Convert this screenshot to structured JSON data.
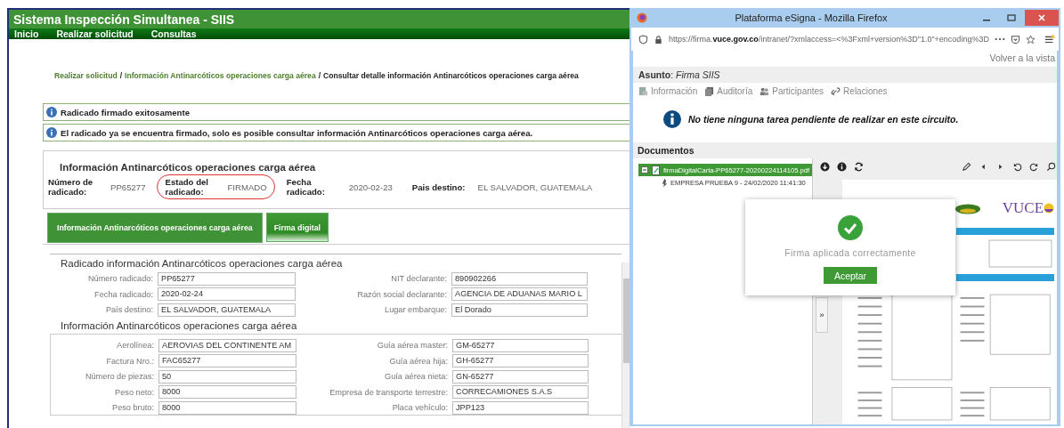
{
  "app": {
    "title": "Sistema Inspección Simultanea - SIIS",
    "nav": [
      "Inicio",
      "Realizar solicitud",
      "Consultas"
    ],
    "breadcrumb": [
      {
        "kind": "link",
        "text": "Realizar solicitud"
      },
      {
        "kind": "separator",
        "text": "/"
      },
      {
        "kind": "link",
        "text": "Información Antinarcóticos operaciones carga aérea"
      },
      {
        "kind": "separator",
        "text": "/"
      },
      {
        "kind": "current",
        "text": "Consultar detalle información Antinarcóticos operaciones carga aérea"
      }
    ],
    "messages": [
      "Radicado firmado exitosamente",
      "El radicado ya se encuentra firmado, solo es posible consultar información Antinarcóticos operaciones carga aérea."
    ],
    "summary": {
      "title": "Información Antinarcóticos operaciones carga aérea",
      "fields": [
        {
          "label": "Número de radicado:",
          "value": "PP65277",
          "highlighted": false
        },
        {
          "label": "Estado del radicado:",
          "value": "FIRMADO",
          "highlighted": true
        },
        {
          "label": "Fecha radicado:",
          "value": "2020-02-23",
          "highlighted": false
        },
        {
          "label": "Pais destino:",
          "value": "EL SALVADOR, GUATEMALA",
          "highlighted": false
        }
      ]
    },
    "tabs": [
      {
        "label": "Información Antinarcóticos operaciones carga aérea",
        "selected": true
      },
      {
        "label": "Firma digital",
        "selected": false
      }
    ],
    "sections": [
      {
        "title": "Radicado información Antinarcóticos operaciones carga aérea",
        "boxed": false,
        "left": [
          {
            "label": "Número radicado:",
            "value": "PP65277"
          },
          {
            "label": "Fecha radicado:",
            "value": "2020-02-24"
          },
          {
            "label": "País destino:",
            "value": "EL SALVADOR, GUATEMALA"
          }
        ],
        "right": [
          {
            "label": "NIT declarante:",
            "value": "890902266"
          },
          {
            "label": "Razón social declarante:",
            "value": "AGENCIA DE ADUANAS MARIO L"
          },
          {
            "label": "Lugar embarque:",
            "value": "El Dorado"
          }
        ]
      },
      {
        "title": "Información Antinarcóticos operaciones carga aérea",
        "boxed": true,
        "left": [
          {
            "label": "Aerolínea:",
            "value": "AEROVIAS DEL CONTINENTE AM"
          },
          {
            "label": "Factura Nro.:",
            "value": "FAC65277"
          },
          {
            "label": "Número de piezas:",
            "value": "50"
          },
          {
            "label": "Peso neto:",
            "value": "8000"
          },
          {
            "label": "Peso bruto:",
            "value": "8000"
          }
        ],
        "right": [
          {
            "label": "Guía aérea master:",
            "value": "GM-65277"
          },
          {
            "label": "Guía aérea hija:",
            "value": "GH-65277"
          },
          {
            "label": "Guía aérea nieta:",
            "value": "GN-65277"
          },
          {
            "label": "Empresa de transporte terrestre:",
            "value": "CORRECAMIONES S.A.S"
          },
          {
            "label": "Placa vehículo:",
            "value": "JPP123"
          }
        ]
      }
    ]
  },
  "browser": {
    "title": "Plataforma eSigna - Mozilla Firefox",
    "url": "https://firma.**vuce.gov.co**/intranet/?xmlaccess=<%3Fxml+version%3D\"1.0\"+encoding%3D",
    "back_link": "Volver a la vista",
    "subject": "**Asunto**: *Firma SIIS*",
    "tools": [
      {
        "kind": "info",
        "label": "Información"
      },
      {
        "kind": "audit",
        "label": "Auditoría"
      },
      {
        "kind": "people",
        "label": "Participantes"
      },
      {
        "kind": "link",
        "label": "Relaciones"
      }
    ],
    "notice": "No tiene ninguna tarea pendiente de realizar en este circuito.",
    "documents_title": "Documentos",
    "tree": [
      {
        "label": "firmaDigitalCarta-PP65277-20200224114105.pdf",
        "selected": true,
        "expanded": true,
        "children": [
          {
            "label": "EMPRESA PRUEBA 9 - 24/02/2020 11:41:30",
            "selected": false
          }
        ]
      }
    ],
    "panel_handle": "»",
    "logo_text": "VUCE",
    "dialog": {
      "message": "Firma aplicada correctamente",
      "button": "Aceptar"
    }
  }
}
